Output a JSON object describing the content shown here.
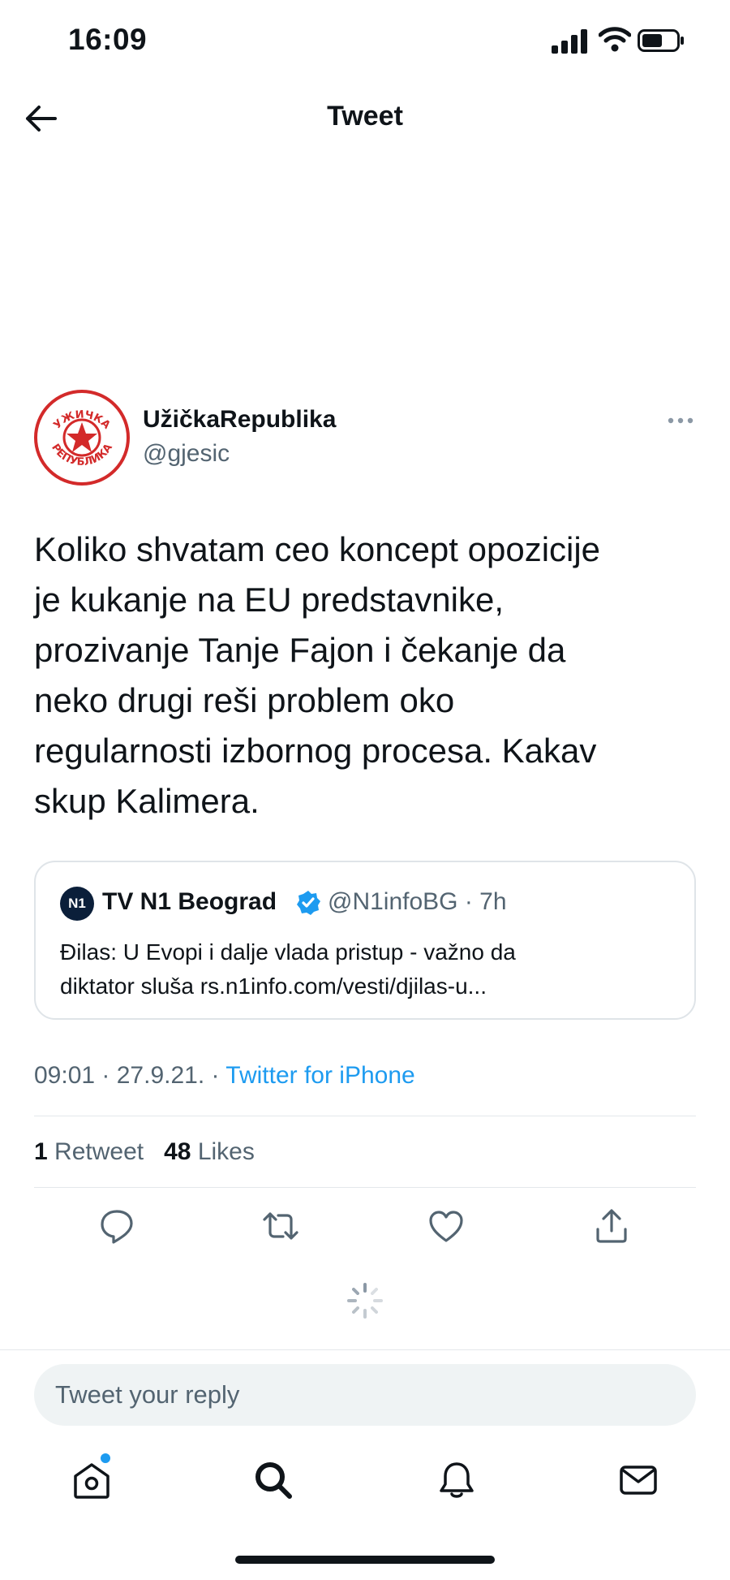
{
  "status_bar": {
    "time": "16:09"
  },
  "header": {
    "title": "Tweet"
  },
  "author": {
    "display_name": "UžičkaRepublika",
    "handle": "@gjesic",
    "avatar_text_top": "УЖИЧКА",
    "avatar_text_bottom": "РЕПУБЛИКА"
  },
  "tweet": {
    "lines": [
      "Koliko shvatam ceo koncept opozicije",
      "je kukanje na EU predstavnike,",
      "prozivanje Tanje Fajon i čekanje da",
      "neko drugi reši problem oko",
      "regularnosti izbornog procesa. Kakav",
      "skup Kalimera."
    ]
  },
  "quote": {
    "logo": "N1",
    "name": "TV N1 Beograd",
    "handle_time": "@N1infoBG · 7h",
    "line1": "Đilas: U Evopi i dalje vlada pristup - važno da",
    "line2": "diktator sluša rs.n1info.com/vesti/djilas-u..."
  },
  "meta": {
    "timestamp": "09:01 · 27.9.21. · ",
    "source": "Twitter for iPhone"
  },
  "stats": {
    "retweets_count": "1",
    "retweets_label": "Retweet",
    "likes_count": "48",
    "likes_label": "Likes"
  },
  "reply": {
    "placeholder": "Tweet your reply"
  },
  "icons": {
    "reply": "reply-icon",
    "retweet": "retweet-icon",
    "like": "heart-icon",
    "share": "share-icon",
    "home": "home-icon",
    "search": "search-icon",
    "notifications": "bell-icon",
    "messages": "mail-icon"
  },
  "colors": {
    "accent": "#1d9bf0",
    "text": "#0f1419",
    "secondary": "#536471",
    "avatar_red": "#d32a2a"
  }
}
